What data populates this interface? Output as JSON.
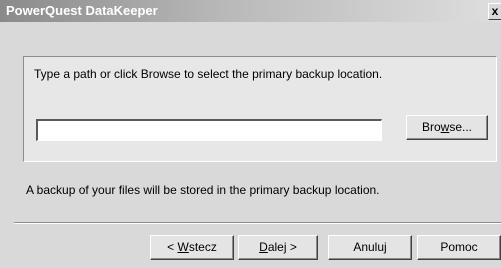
{
  "window": {
    "title": "PowerQuest DataKeeper",
    "close_label": "x"
  },
  "panel": {
    "instruction": "Type a path or click Browse to select the primary backup location.",
    "path_value": "",
    "browse_button": {
      "pre": "Bro",
      "accel": "w",
      "post": "se..."
    }
  },
  "info_text": "A backup of your files will be stored in the primary backup location.",
  "buttons": {
    "back": {
      "pre": "< ",
      "accel": "W",
      "post": "stecz"
    },
    "next": {
      "pre": "",
      "accel": "D",
      "post": "alej >"
    },
    "cancel": {
      "label": "Anuluj"
    },
    "help": {
      "label": "Pomoc"
    }
  },
  "colors": {
    "face": "#d9d9d9",
    "panel": "#e7e7e7",
    "title_gradient_start": "#8a8a8a",
    "title_gradient_end": "#dedede"
  }
}
